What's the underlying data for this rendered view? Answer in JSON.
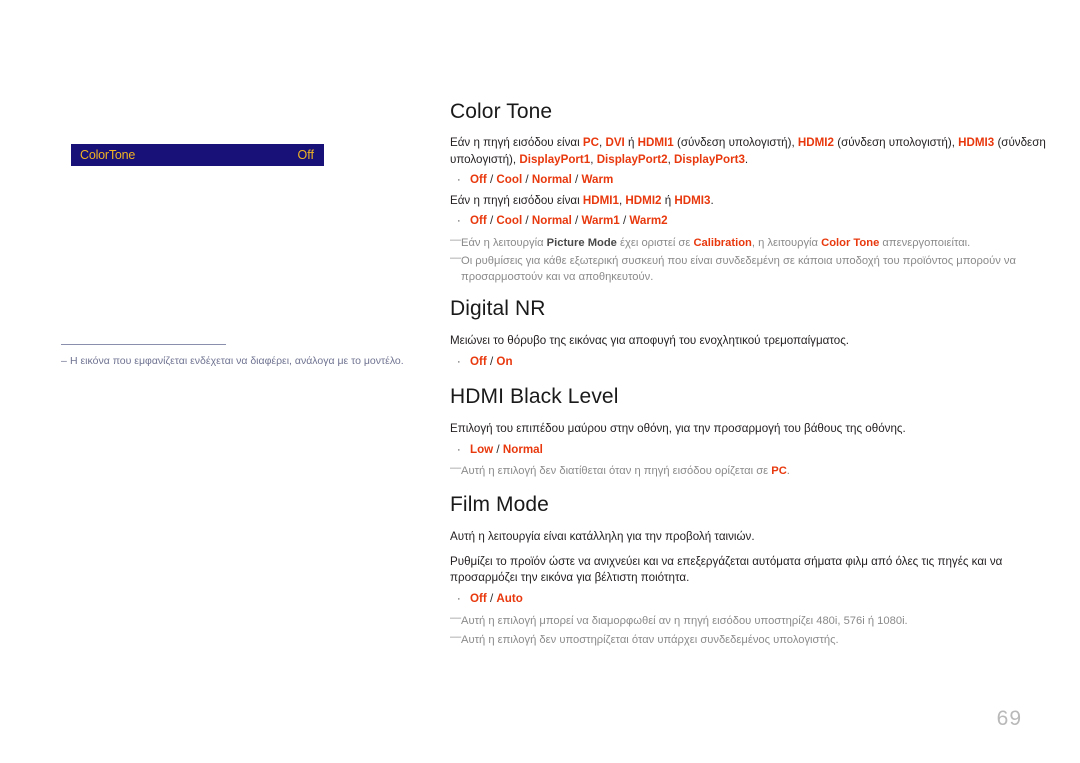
{
  "page": {
    "number": "69"
  },
  "sidebar": {
    "osd": {
      "label": "ColorTone",
      "value": "Off"
    },
    "note": {
      "dash": "–",
      "text": "Η εικόνα που εμφανίζεται ενδέχεται να διαφέρει, ανάλογα με το μοντέλο."
    }
  },
  "sections": [
    {
      "id": "color-tone",
      "heading": "Color Tone",
      "paragraph1_parts": [
        {
          "t": "Εάν η πηγή εισόδου είναι ",
          "hl": false
        },
        {
          "t": "PC",
          "hl": true
        },
        {
          "t": ", ",
          "hl": false
        },
        {
          "t": "DVI",
          "hl": true
        },
        {
          "t": " ή ",
          "hl": false
        },
        {
          "t": "HDMI1",
          "hl": true
        },
        {
          "t": " (σύνδεση υπολογιστή), ",
          "hl": false
        },
        {
          "t": "HDMI2",
          "hl": true
        },
        {
          "t": " (σύνδεση υπολογιστή), ",
          "hl": false
        },
        {
          "t": "HDMI3",
          "hl": true
        },
        {
          "t": " (σύνδεση υπολογιστή), ",
          "hl": false
        },
        {
          "t": "DisplayPort1",
          "hl": true
        },
        {
          "t": ", ",
          "hl": false
        },
        {
          "t": "DisplayPort2",
          "hl": true
        },
        {
          "t": ", ",
          "hl": false
        },
        {
          "t": "DisplayPort3",
          "hl": true
        },
        {
          "t": ".",
          "hl": false
        }
      ],
      "options1": [
        "Off",
        "Cool",
        "Normal",
        "Warm"
      ],
      "paragraph2_parts": [
        {
          "t": "Εάν η πηγή εισόδου είναι ",
          "hl": false
        },
        {
          "t": "HDMI1",
          "hl": true
        },
        {
          "t": ", ",
          "hl": false
        },
        {
          "t": "HDMI2",
          "hl": true
        },
        {
          "t": " ή ",
          "hl": false
        },
        {
          "t": "HDMI3",
          "hl": true
        },
        {
          "t": ".",
          "hl": false
        }
      ],
      "options2": [
        "Off",
        "Cool",
        "Normal",
        "Warm1",
        "Warm2"
      ],
      "notes": [
        [
          {
            "t": "Εάν η λειτουργία ",
            "style": "plain"
          },
          {
            "t": "Picture Mode",
            "style": "bold-dark"
          },
          {
            "t": " έχει οριστεί σε ",
            "style": "plain"
          },
          {
            "t": "Calibration",
            "style": "hl"
          },
          {
            "t": ", η λειτουργία ",
            "style": "plain"
          },
          {
            "t": "Color Tone",
            "style": "hl"
          },
          {
            "t": " απενεργοποιείται.",
            "style": "plain"
          }
        ],
        [
          {
            "t": "Οι ρυθμίσεις για κάθε εξωτερική συσκευή που είναι συνδεδεμένη σε κάποια υποδοχή του προϊόντος μπορούν να προσαρμοστούν και να αποθηκευτούν.",
            "style": "plain"
          }
        ]
      ]
    },
    {
      "id": "digital-nr",
      "heading": "Digital NR",
      "paragraph1_parts": [
        {
          "t": "Μειώνει το θόρυβο της εικόνας για αποφυγή του ενοχλητικού τρεμοπαίγματος.",
          "hl": false
        }
      ],
      "options1": [
        "Off",
        "On"
      ],
      "paragraph2_parts": [],
      "options2": [],
      "notes": []
    },
    {
      "id": "hdmi-black-level",
      "heading": "HDMI Black Level",
      "paragraph1_parts": [
        {
          "t": "Επιλογή του επιπέδου μαύρου στην οθόνη, για την προσαρμογή του βάθους της οθόνης.",
          "hl": false
        }
      ],
      "options1": [
        "Low",
        "Normal"
      ],
      "paragraph2_parts": [],
      "options2": [],
      "notes": [
        [
          {
            "t": "Αυτή η επιλογή δεν διατίθεται όταν η πηγή εισόδου ορίζεται σε ",
            "style": "plain"
          },
          {
            "t": "PC",
            "style": "hl"
          },
          {
            "t": ".",
            "style": "plain"
          }
        ]
      ]
    },
    {
      "id": "film-mode",
      "heading": "Film Mode",
      "paragraph1_parts": [
        {
          "t": "Αυτή η λειτουργία είναι κατάλληλη για την προβολή ταινιών.",
          "hl": false
        }
      ],
      "paragraph_extra_parts": [
        {
          "t": "Ρυθμίζει το προϊόν ώστε να ανιχνεύει και να επεξεργάζεται αυτόματα σήματα φιλμ από όλες τις πηγές και να προσαρμόζει την εικόνα για βέλτιστη ποιότητα.",
          "hl": false
        }
      ],
      "options1": [
        "Off",
        "Auto"
      ],
      "paragraph2_parts": [],
      "options2": [],
      "notes": [
        [
          {
            "t": "Αυτή η επιλογή μπορεί να διαμορφωθεί αν η πηγή εισόδου υποστηρίζει 480i, 576i ή 1080i.",
            "style": "plain"
          }
        ],
        [
          {
            "t": "Αυτή η επιλογή δεν υποστηρίζεται όταν υπάρχει συνδεδεμένος υπολογιστής.",
            "style": "plain"
          }
        ]
      ]
    }
  ],
  "colors": {
    "accent_red": "#e8380d",
    "osd_background": "#181178",
    "osd_text": "#f0b323",
    "note_gray": "#8a8a8a",
    "sidebar_note": "#6f7391"
  }
}
